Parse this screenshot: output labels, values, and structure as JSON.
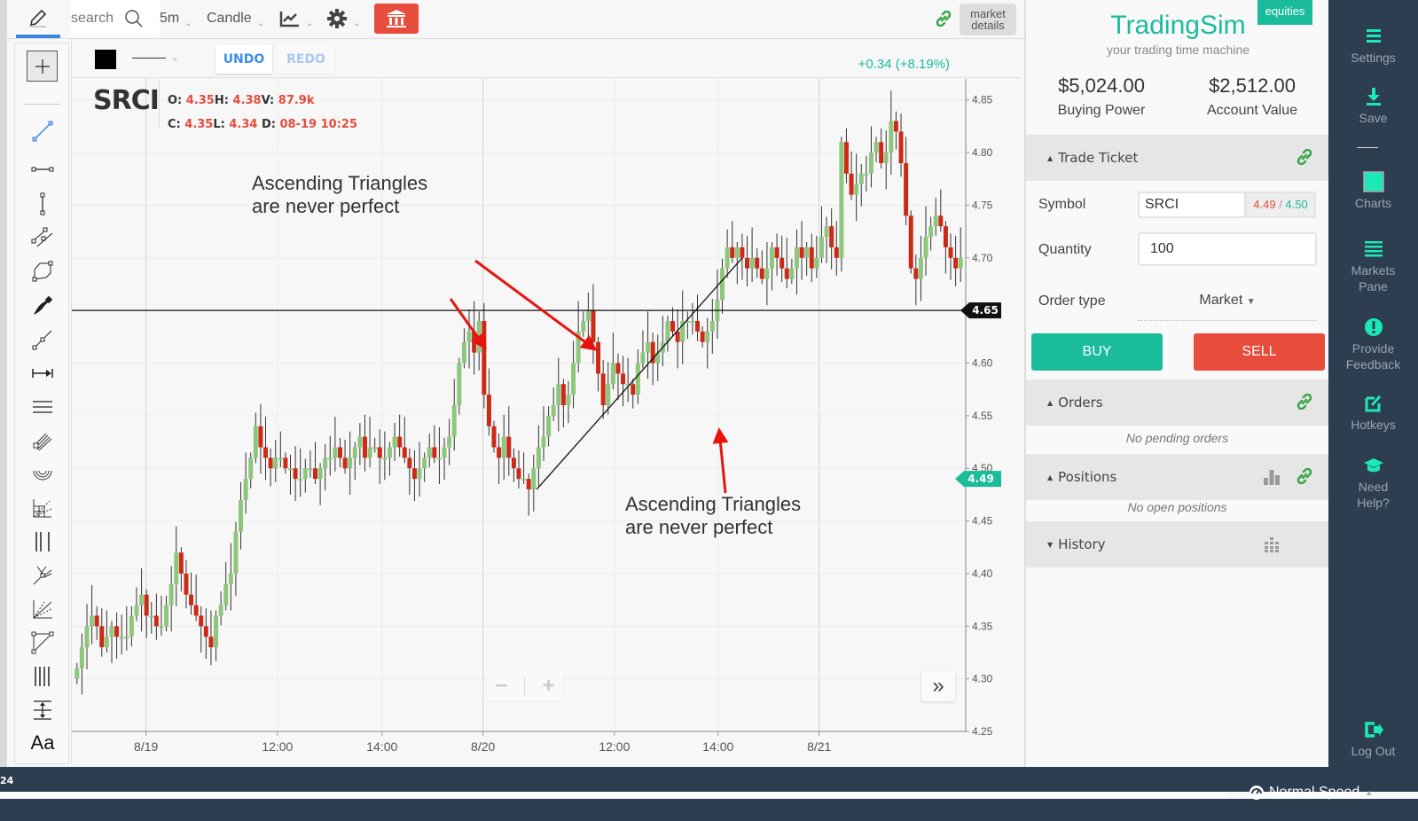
{
  "toolbar": {
    "search_placeholder": "search",
    "interval": "5m",
    "chart_type": "Candle",
    "market_details": "market details"
  },
  "chart_header": {
    "undo": "UNDO",
    "redo": "REDO",
    "change": "+0.34 (+8.19%)",
    "draw_color": "#000000"
  },
  "legend": {
    "symbol": "SRCI",
    "o_label": "O:",
    "o": "4.35",
    "h_label": "H:",
    "h": "4.38",
    "v_label": "V:",
    "v": "87.9k",
    "c_label": "C:",
    "c": "4.35",
    "l_label": "L:",
    "l": "4.34",
    "d_label": "D:",
    "d": "08-19 10:25"
  },
  "annotations": {
    "note_1": [
      "Ascending Triangles",
      "are never perfect"
    ],
    "note_2": [
      "Ascending Triangles",
      "are never perfect"
    ]
  },
  "drawing_tools": [
    "crosshair",
    "trend-line",
    "horizontal-segment",
    "vertical-segment",
    "parallel-channel",
    "polygon",
    "brush",
    "ray",
    "arrow-measure",
    "horizontal-lines",
    "pitchfork-fan",
    "circles",
    "gann-box",
    "vertical-lines",
    "pitchfork",
    "speed-fan",
    "triangle",
    "cycle-lines",
    "price-range",
    "text"
  ],
  "text_tool_label": "Aa",
  "chart_data": {
    "type": "candlestick",
    "symbol": "SRCI",
    "interval": "5m",
    "ylim": [
      4.25,
      4.87
    ],
    "y_ticks": [
      "4.85",
      "4.80",
      "4.75",
      "4.70",
      "4.65",
      "4.60",
      "4.55",
      "4.50",
      "4.45",
      "4.40",
      "4.35",
      "4.30",
      "4.25"
    ],
    "x_ticks": [
      {
        "label": "8/19",
        "pos": 0.083
      },
      {
        "label": "12:00",
        "pos": 0.23
      },
      {
        "label": "14:00",
        "pos": 0.347
      },
      {
        "label": "8/20",
        "pos": 0.46
      },
      {
        "label": "12:00",
        "pos": 0.607
      },
      {
        "label": "14:00",
        "pos": 0.723
      },
      {
        "label": "8/21",
        "pos": 0.836
      }
    ],
    "horizontal_line": {
      "price": 4.65,
      "label": "4.65"
    },
    "last_price": {
      "price": 4.49,
      "label": "4.49"
    },
    "trend_line": {
      "from": [
        0.52,
        4.48
      ],
      "to": [
        0.75,
        4.7
      ]
    },
    "up_color": "#8dc67d",
    "down_color": "#cc2a16",
    "closes": [
      4.31,
      4.33,
      4.35,
      4.36,
      4.35,
      4.33,
      4.34,
      4.35,
      4.34,
      4.34,
      4.34,
      4.36,
      4.37,
      4.38,
      4.36,
      4.36,
      4.35,
      4.35,
      4.37,
      4.39,
      4.42,
      4.4,
      4.38,
      4.37,
      4.36,
      4.35,
      4.34,
      4.33,
      4.36,
      4.37,
      4.39,
      4.4,
      4.44,
      4.47,
      4.49,
      4.51,
      4.54,
      4.52,
      4.51,
      4.5,
      4.51,
      4.51,
      4.5,
      4.5,
      4.49,
      4.49,
      4.5,
      4.5,
      4.49,
      4.5,
      4.51,
      4.51,
      4.52,
      4.51,
      4.5,
      4.51,
      4.52,
      4.53,
      4.51,
      4.52,
      4.52,
      4.51,
      4.51,
      4.52,
      4.53,
      4.52,
      4.51,
      4.5,
      4.49,
      4.5,
      4.51,
      4.52,
      4.51,
      4.51,
      4.52,
      4.53,
      4.56,
      4.6,
      4.62,
      4.63,
      4.61,
      4.64,
      4.57,
      4.54,
      4.52,
      4.51,
      4.53,
      4.51,
      4.5,
      4.49,
      4.49,
      4.48,
      4.5,
      4.52,
      4.53,
      4.55,
      4.56,
      4.58,
      4.56,
      4.57,
      4.6,
      4.63,
      4.64,
      4.65,
      4.62,
      4.59,
      4.56,
      4.58,
      4.6,
      4.59,
      4.58,
      4.58,
      4.57,
      4.6,
      4.61,
      4.62,
      4.6,
      4.61,
      4.62,
      4.64,
      4.63,
      4.62,
      4.64,
      4.64,
      4.64,
      4.63,
      4.62,
      4.63,
      4.64,
      4.66,
      4.69,
      4.71,
      4.7,
      4.71,
      4.7,
      4.69,
      4.7,
      4.69,
      4.68,
      4.69,
      4.71,
      4.7,
      4.69,
      4.68,
      4.69,
      4.71,
      4.7,
      4.71,
      4.69,
      4.7,
      4.72,
      4.73,
      4.71,
      4.7,
      4.81,
      4.78,
      4.76,
      4.77,
      4.78,
      4.78,
      4.8,
      4.81,
      4.79,
      4.8,
      4.83,
      4.82,
      4.79,
      4.74,
      4.69,
      4.68,
      4.7,
      4.72,
      4.73,
      4.74,
      4.73,
      4.71,
      4.7,
      4.69,
      4.7
    ]
  },
  "trade_panel": {
    "badge": "equities",
    "brand": "TradingSim",
    "tagline": "your trading time machine",
    "buying_power": "$5,024.00",
    "buying_power_label": "Buying Power",
    "account_value": "$2,512.00",
    "account_value_label": "Account Value",
    "trade_ticket": {
      "title": "Trade Ticket",
      "symbol_label": "Symbol",
      "symbol_value": "SRCI",
      "bid": "4.49",
      "ask": "4.50",
      "quantity_label": "Quantity",
      "quantity_value": "100",
      "order_type_label": "Order type",
      "order_type_value": "Market",
      "buy": "BUY",
      "sell": "SELL"
    },
    "orders": {
      "title": "Orders",
      "empty": "No pending orders"
    },
    "positions": {
      "title": "Positions",
      "empty": "No open positions"
    },
    "history": {
      "title": "History"
    }
  },
  "nav": {
    "settings": "Settings",
    "save": "Save",
    "charts": "Charts",
    "markets_pane": [
      "Markets",
      "Pane"
    ],
    "feedback": [
      "Provide",
      "Feedback"
    ],
    "hotkeys": "Hotkeys",
    "help": [
      "Need",
      "Help?"
    ],
    "logout": "Log Out"
  },
  "status": {
    "left_text": "24",
    "speed": "Normal Speed",
    "replay_progress": 0.865
  }
}
